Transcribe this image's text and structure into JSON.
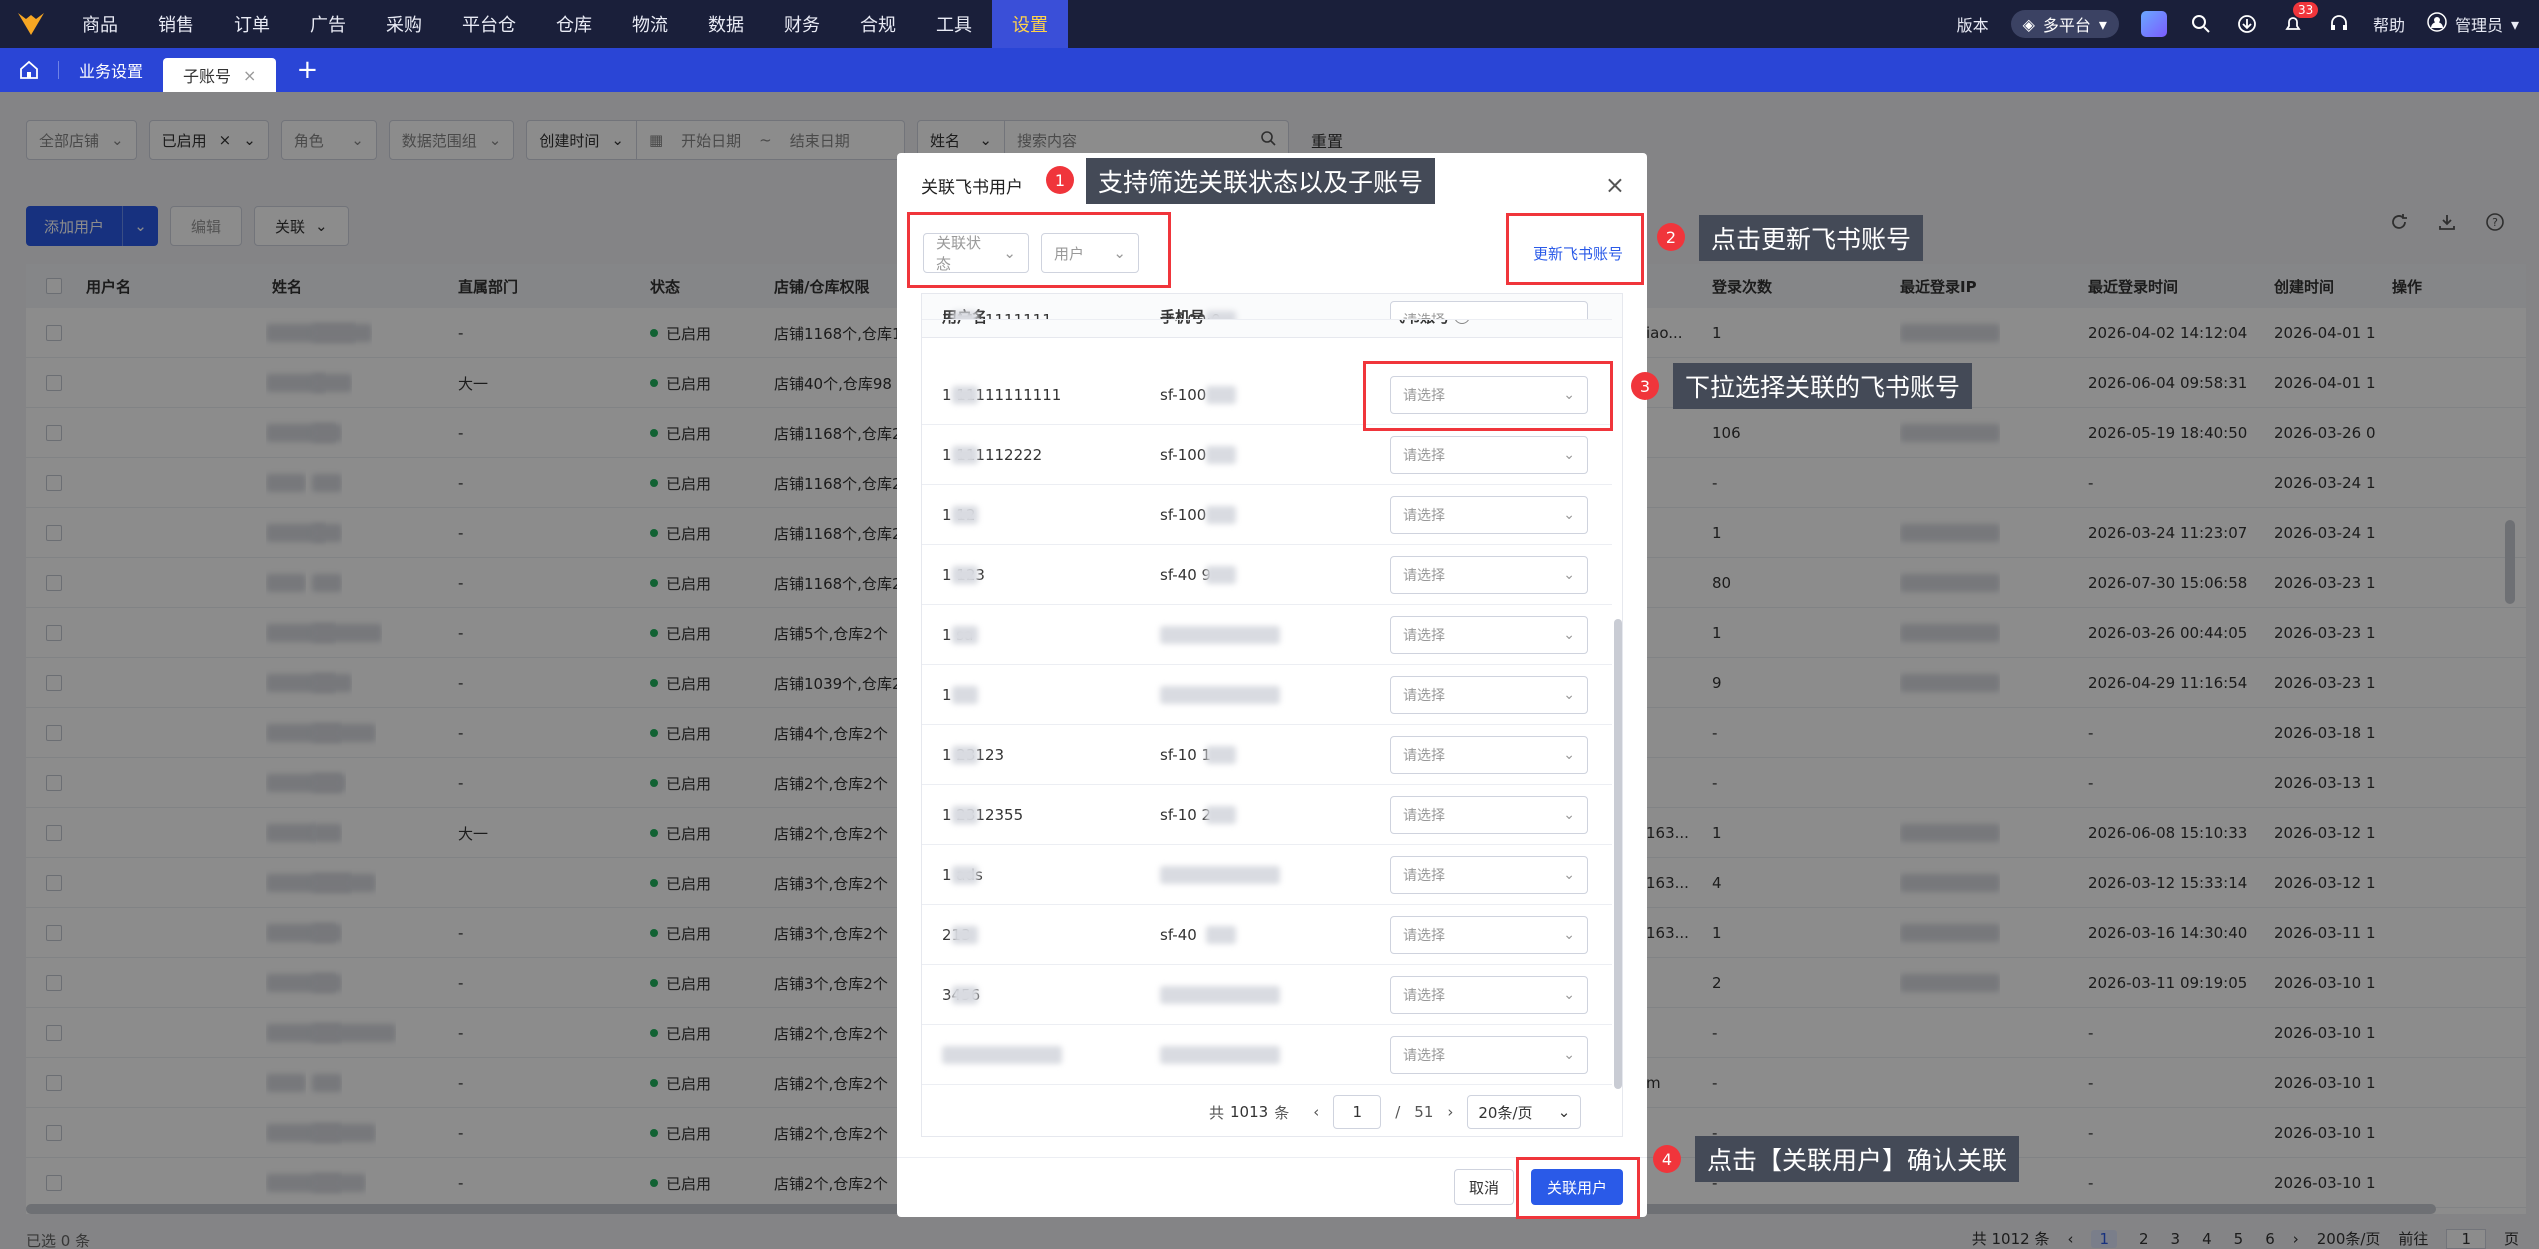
{
  "nav": {
    "items": [
      "商品",
      "销售",
      "订单",
      "广告",
      "采购",
      "平台仓",
      "仓库",
      "物流",
      "数据",
      "财务",
      "合规",
      "工具",
      "设置"
    ],
    "active_index": 12,
    "version_label": "版本",
    "platform_label": "多平台",
    "notification_count": "33",
    "help_label": "帮助",
    "user_label": "管理员"
  },
  "tabs": {
    "breadcrumb": "业务设置",
    "active_tab": "子账号",
    "add": "+"
  },
  "filters": {
    "store": "全部店铺",
    "status": "已启用",
    "role": "角色",
    "data_range": "数据范围组",
    "time_type": "创建时间",
    "start_date": "开始日期",
    "range_sep": "~",
    "end_date": "结束日期",
    "search_field": "姓名",
    "search_placeholder": "搜索内容",
    "reset": "重置"
  },
  "toolbar": {
    "add_user": "添加用户",
    "edit": "编辑",
    "link": "关联"
  },
  "table": {
    "headers": [
      "用户名",
      "姓名",
      "直属部门",
      "状态",
      "店铺/仓库权限",
      "登录次数",
      "最近登录IP",
      "最近登录时间",
      "创建时间",
      "操作"
    ],
    "rows": [
      {
        "dept": "-",
        "status": "已启用",
        "perm": "店铺1168个,仓库1",
        "ext": "iao...",
        "count": "1",
        "last_login": "2026-04-02 14:12:04",
        "created": "2026-04-01 1"
      },
      {
        "dept": "大一",
        "status": "已启用",
        "perm": "店铺40个,仓库98",
        "ext": "",
        "count": "",
        "last_login": "2026-06-04 09:58:31",
        "created": "2026-04-01 1"
      },
      {
        "dept": "-",
        "status": "已启用",
        "perm": "店铺1168个,仓库2",
        "ext": "",
        "count": "106",
        "last_login": "2026-05-19 18:40:50",
        "created": "2026-03-26 0"
      },
      {
        "dept": "-",
        "status": "已启用",
        "perm": "店铺1168个,仓库2",
        "ext": "",
        "count": "-",
        "last_login": "-",
        "created": "2026-03-24 1"
      },
      {
        "dept": "-",
        "status": "已启用",
        "perm": "店铺1168个,仓库2",
        "ext": "",
        "count": "1",
        "last_login": "2026-03-24 11:23:07",
        "created": "2026-03-24 1"
      },
      {
        "dept": "-",
        "status": "已启用",
        "perm": "店铺1168个,仓库2",
        "ext": "",
        "count": "80",
        "last_login": "2026-07-30 15:06:58",
        "created": "2026-03-23 1"
      },
      {
        "dept": "-",
        "status": "已启用",
        "perm": "店铺5个,仓库2个",
        "ext": "",
        "count": "1",
        "last_login": "2026-03-26 00:44:05",
        "created": "2026-03-23 1"
      },
      {
        "dept": "-",
        "status": "已启用",
        "perm": "店铺1039个,仓库2",
        "ext": "",
        "count": "9",
        "last_login": "2026-04-29 11:16:54",
        "created": "2026-03-23 1"
      },
      {
        "dept": "-",
        "status": "已启用",
        "perm": "店铺4个,仓库2个",
        "ext": "",
        "count": "-",
        "last_login": "-",
        "created": "2026-03-18 1"
      },
      {
        "dept": "-",
        "status": "已启用",
        "perm": "店铺2个,仓库2个",
        "ext": "",
        "count": "-",
        "last_login": "-",
        "created": "2026-03-13 1"
      },
      {
        "dept": "大一",
        "status": "已启用",
        "perm": "店铺2个,仓库2个",
        "ext": "163...",
        "count": "1",
        "last_login": "2026-06-08 15:10:33",
        "created": "2026-03-12 1"
      },
      {
        "dept": "",
        "status": "已启用",
        "perm": "店铺3个,仓库2个",
        "ext": "163...",
        "count": "4",
        "last_login": "2026-03-12 15:33:14",
        "created": "2026-03-12 1"
      },
      {
        "dept": "-",
        "status": "已启用",
        "perm": "店铺3个,仓库2个",
        "ext": "163...",
        "count": "1",
        "last_login": "2026-03-16 14:30:40",
        "created": "2026-03-11 1"
      },
      {
        "dept": "-",
        "status": "已启用",
        "perm": "店铺3个,仓库2个",
        "ext": "",
        "count": "2",
        "last_login": "2026-03-11 09:19:05",
        "created": "2026-03-10 1"
      },
      {
        "dept": "-",
        "status": "已启用",
        "perm": "店铺2个,仓库2个",
        "ext": "",
        "count": "-",
        "last_login": "-",
        "created": "2026-03-10 1"
      },
      {
        "dept": "-",
        "status": "已启用",
        "perm": "店铺2个,仓库2个",
        "ext": "m",
        "count": "-",
        "last_login": "-",
        "created": "2026-03-10 1"
      },
      {
        "dept": "-",
        "status": "已启用",
        "perm": "店铺2个,仓库2个",
        "ext": "",
        "count": "-",
        "last_login": "-",
        "created": "2026-03-10 1"
      },
      {
        "dept": "-",
        "status": "已启用",
        "perm": "店铺2个,仓库2个",
        "ext": "",
        "count": "-",
        "last_login": "-",
        "created": "2026-03-10 1"
      }
    ]
  },
  "footer": {
    "selected": "已选 0 条",
    "total": "共 1012 条",
    "pages": [
      "1",
      "2",
      "3",
      "4",
      "5",
      "6"
    ],
    "page_size": "200条/页",
    "goto_label": "前往",
    "goto_value": "1",
    "page_suffix": "页"
  },
  "modal": {
    "title": "关联飞书用户",
    "close": "×",
    "filter_status": "关联状态",
    "filter_user": "用户",
    "update_link": "更新飞书账号",
    "headers": [
      "用户名",
      "手机号",
      "飞书账号"
    ],
    "help_mark": "?",
    "select_placeholder": "请选择",
    "rows": [
      {
        "username": "7·1111111111",
        "phone": "sf-100·0"
      },
      {
        "username": "1  11111111111",
        "phone": "sf-100"
      },
      {
        "username": "1  111112222",
        "phone": "sf-100"
      },
      {
        "username": "1  12",
        "phone": "sf-100"
      },
      {
        "username": "1  123",
        "phone": "sf-40  9"
      },
      {
        "username": "1  sa",
        "phone": ""
      },
      {
        "username": "1",
        "phone": ""
      },
      {
        "username": "1  23123",
        "phone": "sf-10  1"
      },
      {
        "username": "1  2312355",
        "phone": "sf-10  2"
      },
      {
        "username": "1  ads",
        "phone": ""
      },
      {
        "username": "  213",
        "phone": "sf-40"
      },
      {
        "username": "  3456",
        "phone": ""
      },
      {
        "username": "",
        "phone": ""
      }
    ],
    "pager": {
      "total_prefix": "共",
      "total": "1013",
      "total_suffix": "条",
      "current": "1",
      "sep": "/",
      "pages": "51",
      "page_size": "20条/页"
    },
    "cancel": "取消",
    "confirm": "关联用户"
  },
  "annotations": [
    {
      "num": "1",
      "text": "支持筛选关联状态以及子账号"
    },
    {
      "num": "2",
      "text": "点击更新飞书账号"
    },
    {
      "num": "3",
      "text": "下拉选择关联的飞书账号"
    },
    {
      "num": "4",
      "text": "点击【关联用户】确认关联"
    }
  ],
  "colors": {
    "nav_bg": "#1a1f3a",
    "tabbar_bg": "#2a45d6",
    "primary": "#2a5ae8",
    "annotation_red": "#f0353b",
    "status_green": "#22b35e"
  }
}
